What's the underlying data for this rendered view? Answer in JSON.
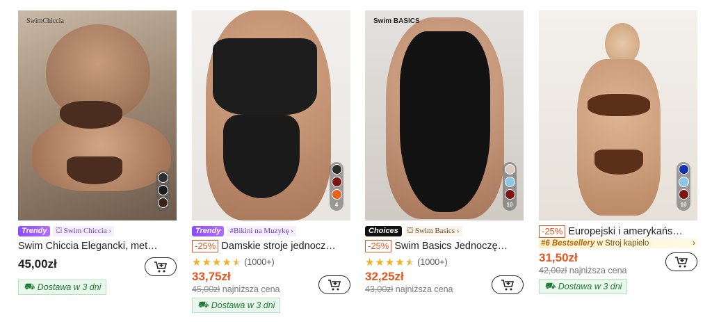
{
  "products": [
    {
      "image_brand": "SwimChiccia",
      "badge": "Trendy",
      "store": "Swim Chiccia",
      "title": "Swim Chiccia Elegancki, met…",
      "price": "45,00zł",
      "delivery": "Dostawa w 3 dni",
      "swatches": [
        "#2a2f2f",
        "#1b1d1d",
        "#3a2218"
      ]
    },
    {
      "badge": "Trendy",
      "store": "#Bikini na Muzykę",
      "discount": "-25%",
      "title": "Damskie stroje jednocz…",
      "rating_count": "(1000+)",
      "rating": 4.5,
      "price": "33,75zł",
      "old_price": "45,00zł",
      "old_price_label": "najniższa cena",
      "delivery": "Dostawa w 3 dni",
      "swatches": [
        "#2b2b2b",
        "#7c1414",
        "#e4631d"
      ],
      "swatch_count": "4"
    },
    {
      "image_brand": "Swim BASICS",
      "badge": "Choices",
      "store": "Swim Basics",
      "discount": "-25%",
      "title": "Swim Basics Jednoczę…",
      "rating_count": "(1000+)",
      "rating": 4.5,
      "price": "32,25zł",
      "old_price": "43,00zł",
      "old_price_label": "najniższa cena",
      "swatches": [
        "#d8ccc0",
        "#8cc6e6",
        "#7a1414"
      ],
      "swatch_count": "10"
    },
    {
      "discount": "-25%",
      "title": "Europejski i amerykańs…",
      "bestseller_rank": "#6 Bestsellery",
      "bestseller_in": "w Stroj kapielo",
      "price": "31,50zł",
      "old_price": "42,00zł",
      "old_price_label": "najniższa cena",
      "delivery": "Dostawa w 3 dni",
      "swatches": [
        "#1530b0",
        "#8cc6e6",
        "#7a1414"
      ],
      "swatch_count": "10"
    }
  ],
  "icons": {
    "cart": "add-to-cart-icon",
    "truck": "truck-icon",
    "chevron": "chevron-right-icon",
    "store": "store-icon"
  },
  "colors": {
    "sale": "#e8541e",
    "delivery_text": "#1f7a3a",
    "trendy": "#8a4bff"
  }
}
